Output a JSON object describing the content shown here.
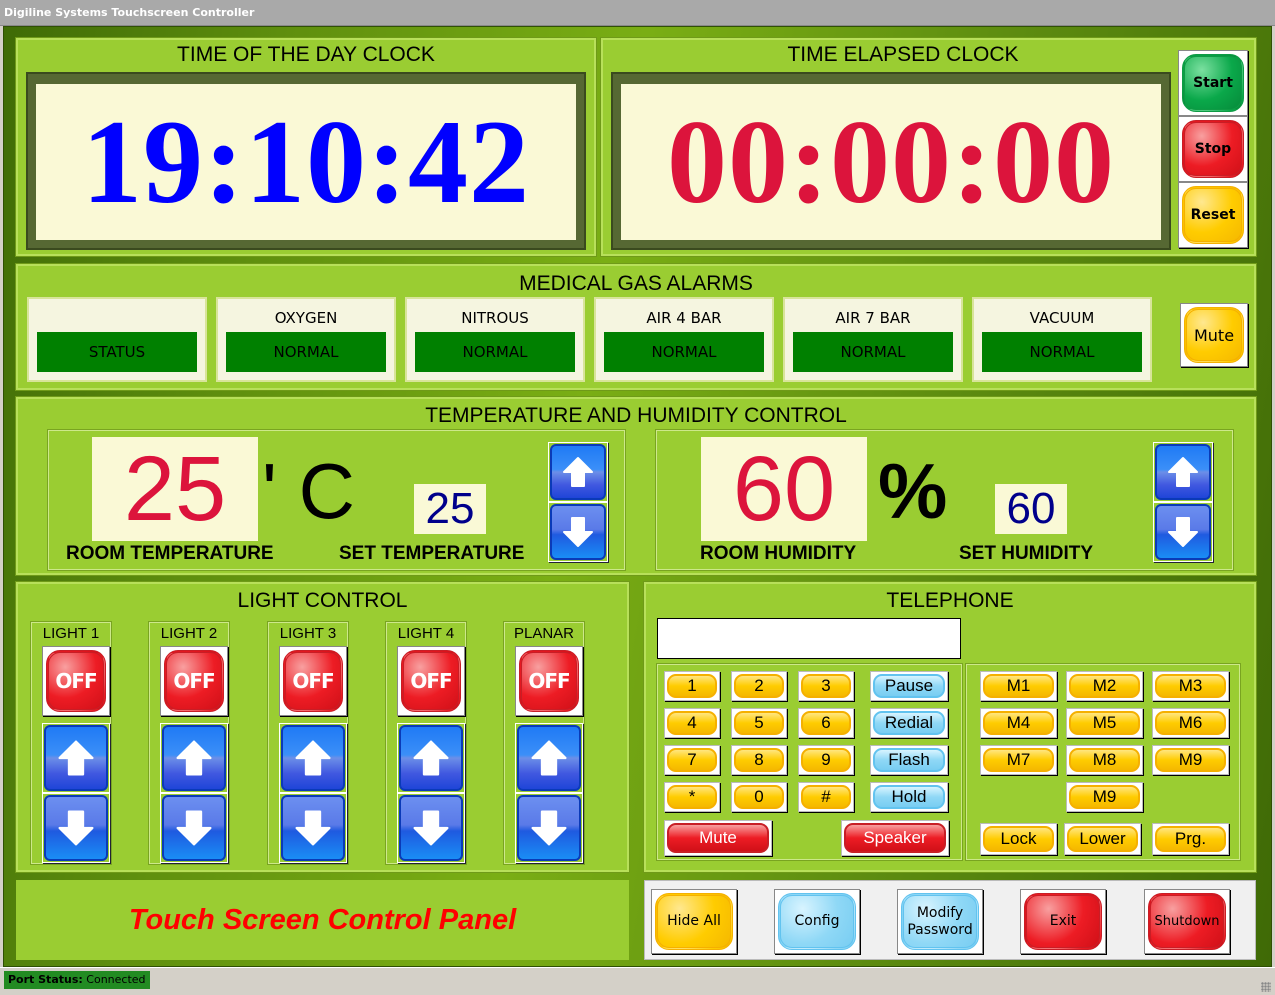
{
  "window": {
    "title": "Digiline Systems Touchscreen Controller"
  },
  "time_of_day": {
    "title": "TIME OF THE DAY CLOCK",
    "value": "19:10:42",
    "color": "#0000ff"
  },
  "elapsed": {
    "title": "TIME ELAPSED CLOCK",
    "value": "00:00:00",
    "color": "#dc143c",
    "buttons": {
      "start": "Start",
      "stop": "Stop",
      "reset": "Reset"
    }
  },
  "gas_alarms": {
    "title": "MEDICAL GAS ALARMS",
    "mute_label": "Mute",
    "items": [
      {
        "label": "",
        "status": "STATUS"
      },
      {
        "label": "OXYGEN",
        "status": "NORMAL"
      },
      {
        "label": "NITROUS",
        "status": "NORMAL"
      },
      {
        "label": "AIR 4 BAR",
        "status": "NORMAL"
      },
      {
        "label": "AIR 7 BAR",
        "status": "NORMAL"
      },
      {
        "label": "VACUUM",
        "status": "NORMAL"
      }
    ],
    "status_color": "#008000"
  },
  "climate": {
    "title": "TEMPERATURE AND HUMIDITY CONTROL",
    "temperature": {
      "room_value": "25",
      "unit": "' C",
      "set_value": "25",
      "room_label": "ROOM TEMPERATURE",
      "set_label": "SET TEMPERATURE"
    },
    "humidity": {
      "room_value": "60",
      "unit": "%",
      "set_value": "60",
      "room_label": "ROOM HUMIDITY",
      "set_label": "SET HUMIDITY"
    }
  },
  "lights": {
    "title": "LIGHT CONTROL",
    "items": [
      {
        "label": "LIGHT 1",
        "state": "OFF"
      },
      {
        "label": "LIGHT 2",
        "state": "OFF"
      },
      {
        "label": "LIGHT 3",
        "state": "OFF"
      },
      {
        "label": "LIGHT 4",
        "state": "OFF"
      },
      {
        "label": "PLANAR",
        "state": "OFF"
      }
    ]
  },
  "telephone": {
    "title": "TELEPHONE",
    "display_value": "",
    "keypad": [
      [
        "1",
        "2",
        "3"
      ],
      [
        "4",
        "5",
        "6"
      ],
      [
        "7",
        "8",
        "9"
      ],
      [
        "*",
        "0",
        "#"
      ]
    ],
    "functions": [
      "Pause",
      "Redial",
      "Flash",
      "Hold"
    ],
    "mute_label": "Mute",
    "speaker_label": "Speaker",
    "memory": [
      [
        "M1",
        "M2",
        "M3"
      ],
      [
        "M4",
        "M5",
        "M6"
      ],
      [
        "M7",
        "M8",
        "M9"
      ],
      [
        "M9"
      ]
    ],
    "lock_label": "Lock",
    "lower_label": "Lower",
    "prg_label": "Prg."
  },
  "banner": {
    "text": "Touch Screen Control Panel",
    "color": "#ff0000"
  },
  "actions": {
    "hide_all": "Hide All",
    "config": "Config",
    "modify_password": "Modify Password",
    "exit": "Exit",
    "shutdown": "Shutdown"
  },
  "status_bar": {
    "port_label": "Port Status:",
    "port_value": "Connected"
  }
}
